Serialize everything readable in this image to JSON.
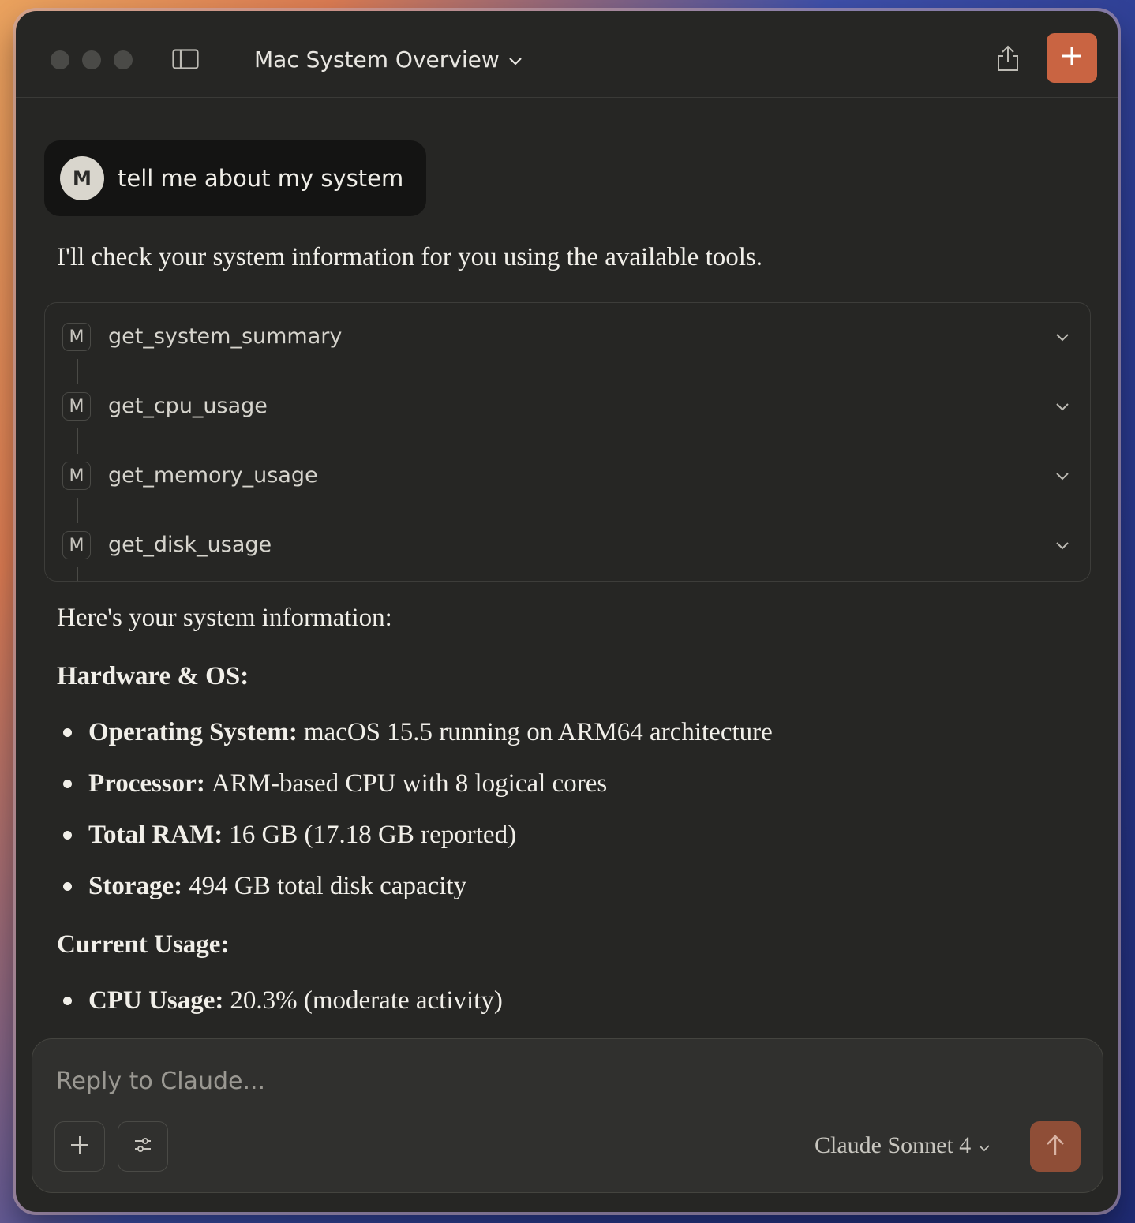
{
  "window": {
    "title": "Mac System Overview"
  },
  "conversation": {
    "user_message": {
      "avatar_initial": "M",
      "text": "tell me about my system"
    },
    "assistant_intro": "I'll check your system information for you using the available tools.",
    "tools": [
      {
        "badge": "M",
        "name": "get_system_summary"
      },
      {
        "badge": "M",
        "name": "get_cpu_usage"
      },
      {
        "badge": "M",
        "name": "get_memory_usage"
      },
      {
        "badge": "M",
        "name": "get_disk_usage"
      }
    ],
    "summary_heading": "Here's your system information:",
    "sections": [
      {
        "title": "Hardware & OS:",
        "items": [
          {
            "label": "Operating System:",
            "value": "macOS 15.5 running on ARM64 architecture"
          },
          {
            "label": "Processor:",
            "value": "ARM-based CPU with 8 logical cores"
          },
          {
            "label": "Total RAM:",
            "value": "16 GB (17.18 GB reported)"
          },
          {
            "label": "Storage:",
            "value": "494 GB total disk capacity"
          }
        ]
      },
      {
        "title": "Current Usage:",
        "items": [
          {
            "label": "CPU Usage:",
            "value": "20.3% (moderate activity)"
          }
        ]
      }
    ]
  },
  "composer": {
    "placeholder": "Reply to Claude...",
    "model_name": "Claude Sonnet 4"
  },
  "icons": {
    "sidebar": "sidebar-toggle-icon",
    "share": "share-icon",
    "new_chat": "plus-icon",
    "attach": "plus-icon",
    "tools": "sliders-icon",
    "send": "arrow-up-icon"
  },
  "colors": {
    "accent": "#c96442",
    "send_button": "#8f4e37",
    "window_bg": "#262624",
    "user_bubble_bg": "#141413"
  }
}
